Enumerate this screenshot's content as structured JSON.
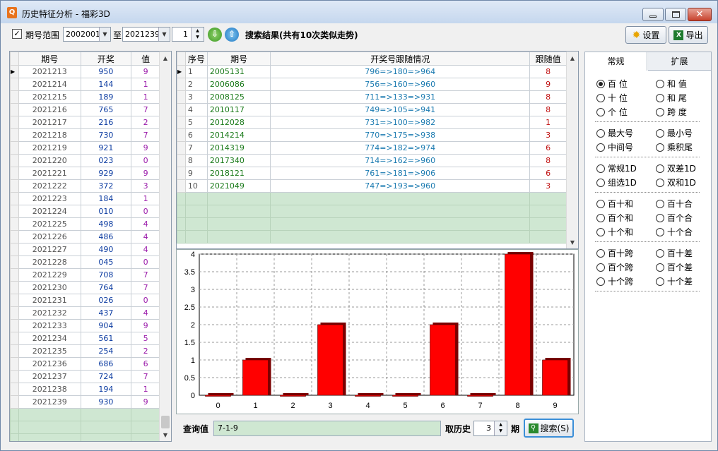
{
  "window": {
    "title": "历史特征分析 - 福彩3D"
  },
  "toolbar": {
    "range_label": "期号范围",
    "from_value": "2002001",
    "to_label": "至",
    "to_value": "2021239",
    "spin_value": "1",
    "search_result": "搜索结果(共有10次类似走势)",
    "settings_label": "设置",
    "export_label": "导出"
  },
  "left_table": {
    "columns": [
      "期号",
      "开奖",
      "值"
    ],
    "rows": [
      [
        "2021213",
        "950",
        "9"
      ],
      [
        "2021214",
        "144",
        "1"
      ],
      [
        "2021215",
        "189",
        "1"
      ],
      [
        "2021216",
        "765",
        "7"
      ],
      [
        "2021217",
        "216",
        "2"
      ],
      [
        "2021218",
        "730",
        "7"
      ],
      [
        "2021219",
        "921",
        "9"
      ],
      [
        "2021220",
        "023",
        "0"
      ],
      [
        "2021221",
        "929",
        "9"
      ],
      [
        "2021222",
        "372",
        "3"
      ],
      [
        "2021223",
        "184",
        "1"
      ],
      [
        "2021224",
        "010",
        "0"
      ],
      [
        "2021225",
        "498",
        "4"
      ],
      [
        "2021226",
        "486",
        "4"
      ],
      [
        "2021227",
        "490",
        "4"
      ],
      [
        "2021228",
        "045",
        "0"
      ],
      [
        "2021229",
        "708",
        "7"
      ],
      [
        "2021230",
        "764",
        "7"
      ],
      [
        "2021231",
        "026",
        "0"
      ],
      [
        "2021232",
        "437",
        "4"
      ],
      [
        "2021233",
        "904",
        "9"
      ],
      [
        "2021234",
        "561",
        "5"
      ],
      [
        "2021235",
        "254",
        "2"
      ],
      [
        "2021236",
        "686",
        "6"
      ],
      [
        "2021237",
        "724",
        "7"
      ],
      [
        "2021238",
        "194",
        "1"
      ],
      [
        "2021239",
        "930",
        "9"
      ]
    ]
  },
  "result_table": {
    "columns": [
      "序号",
      "期号",
      "开奖号跟随情况",
      "跟随值"
    ],
    "rows": [
      [
        "1",
        "2005131",
        "796=>180=>964",
        "8"
      ],
      [
        "2",
        "2006086",
        "756=>160=>960",
        "9"
      ],
      [
        "3",
        "2008125",
        "711=>133=>931",
        "8"
      ],
      [
        "4",
        "2010117",
        "749=>105=>941",
        "8"
      ],
      [
        "5",
        "2012028",
        "731=>100=>982",
        "1"
      ],
      [
        "6",
        "2014214",
        "770=>175=>938",
        "3"
      ],
      [
        "7",
        "2014319",
        "774=>182=>974",
        "6"
      ],
      [
        "8",
        "2017340",
        "714=>162=>960",
        "8"
      ],
      [
        "9",
        "2018121",
        "761=>181=>906",
        "6"
      ],
      [
        "10",
        "2021049",
        "747=>193=>960",
        "3"
      ]
    ]
  },
  "chart_data": {
    "type": "bar",
    "categories": [
      "0",
      "1",
      "2",
      "3",
      "4",
      "5",
      "6",
      "7",
      "8",
      "9"
    ],
    "values": [
      0,
      1,
      0,
      2,
      0,
      0,
      2,
      0,
      4,
      1
    ],
    "ylim": [
      0,
      4
    ],
    "yticks": [
      "0",
      "0.5",
      "1",
      "1.5",
      "2",
      "2.5",
      "3",
      "3.5",
      "4"
    ],
    "title": "",
    "xlabel": "",
    "ylabel": "",
    "grid": true,
    "bar_color": "#ff0000"
  },
  "query": {
    "label": "查询值",
    "value": "7-1-9",
    "history_label": "取历史",
    "history_value": "3",
    "period_label": "期",
    "search_label": "搜索(S)"
  },
  "right_panel": {
    "tabs": [
      "常规",
      "扩展"
    ],
    "groups": [
      [
        [
          "百 位",
          true
        ],
        [
          "和 值",
          false
        ],
        [
          "十 位",
          false
        ],
        [
          "和 尾",
          false
        ],
        [
          "个 位",
          false
        ],
        [
          "跨 度",
          false
        ]
      ],
      [
        [
          "最大号",
          false
        ],
        [
          "最小号",
          false
        ],
        [
          "中间号",
          false
        ],
        [
          "乘积尾",
          false
        ]
      ],
      [
        [
          "常规1D",
          false
        ],
        [
          "双差1D",
          false
        ],
        [
          "组选1D",
          false
        ],
        [
          "双和1D",
          false
        ]
      ],
      [
        [
          "百十和",
          false
        ],
        [
          "百十合",
          false
        ],
        [
          "百个和",
          false
        ],
        [
          "百个合",
          false
        ],
        [
          "十个和",
          false
        ],
        [
          "十个合",
          false
        ]
      ],
      [
        [
          "百十跨",
          false
        ],
        [
          "百十差",
          false
        ],
        [
          "百个跨",
          false
        ],
        [
          "百个差",
          false
        ],
        [
          "十个跨",
          false
        ],
        [
          "十个差",
          false
        ]
      ]
    ]
  },
  "colors": {
    "period_text": "#1a7a1a",
    "number_text": "#0a3aa0",
    "value_text": "#9a1aaa",
    "grid_empty": "#cfe7d2"
  }
}
